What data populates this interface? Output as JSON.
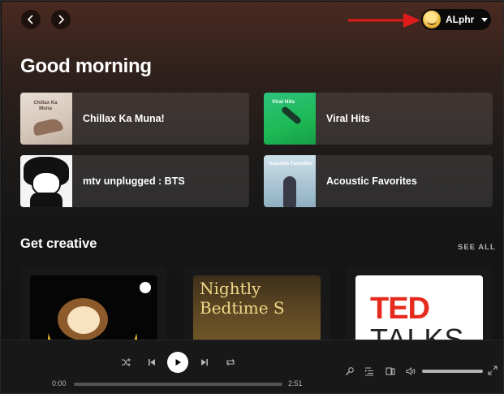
{
  "topbar": {
    "back_label": "back",
    "forward_label": "forward",
    "user_name": "ALphr"
  },
  "greeting": "Good morning",
  "shortcuts": [
    {
      "label": "Chillax Ka Muna!",
      "art_text": "Chillax Ka Muna"
    },
    {
      "label": "Viral Hits",
      "art_text": "Viral Hits"
    },
    {
      "label": "mtv unplugged : BTS"
    },
    {
      "label": "Acoustic Favorites",
      "art_text": "Acoustic Favorites"
    }
  ],
  "section": {
    "title": "Get creative",
    "see_all": "SEE ALL",
    "cards": [
      {
        "art": "sleep"
      },
      {
        "art_text": "Nightly Bedtime S"
      },
      {
        "art_title": "TED",
        "art_sub": "TALKS"
      }
    ]
  },
  "player": {
    "elapsed": "0:00",
    "duration": "2:51",
    "progress": 0,
    "volume": 1.0
  },
  "colors": {
    "accent": "#1db954",
    "annotation_arrow": "#e01b1b"
  },
  "icons": [
    "chevron-left-icon",
    "chevron-right-icon",
    "caret-down-icon",
    "shuffle-icon",
    "skip-back-icon",
    "play-icon",
    "skip-forward-icon",
    "repeat-icon",
    "lyrics-icon",
    "queue-icon",
    "devices-icon",
    "volume-icon",
    "fullscreen-icon"
  ]
}
